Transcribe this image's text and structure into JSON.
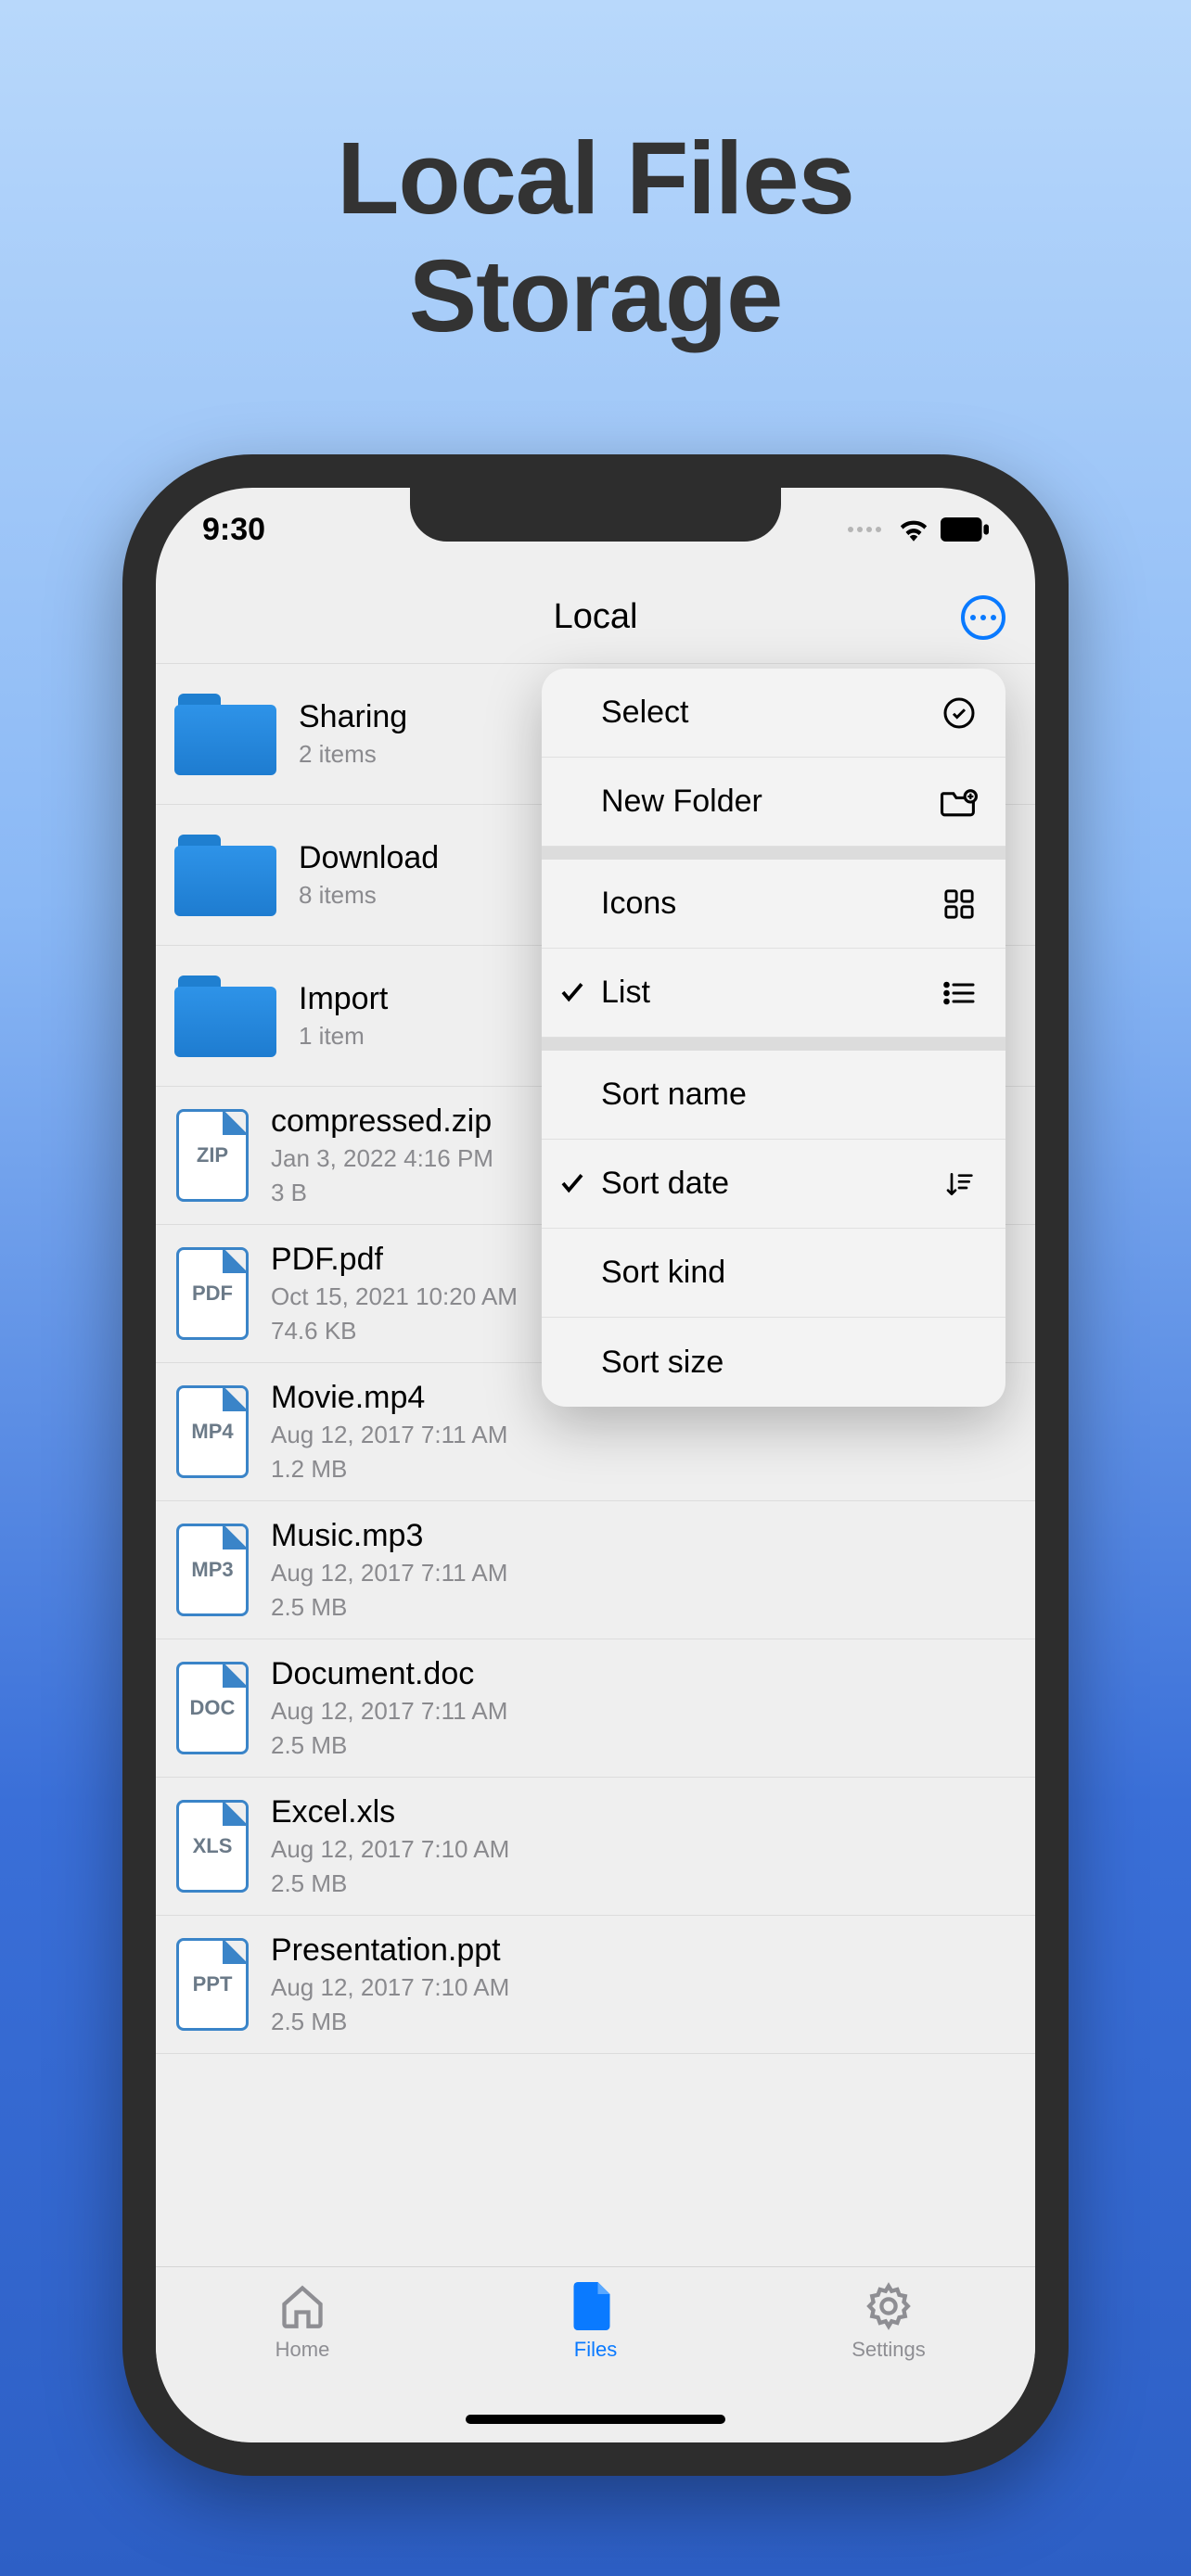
{
  "promo": {
    "line1": "Local Files",
    "line2": "Storage"
  },
  "status": {
    "time": "9:30"
  },
  "nav": {
    "title": "Local"
  },
  "folders": [
    {
      "name": "Sharing",
      "sub": "2 items"
    },
    {
      "name": "Download",
      "sub": "8 items"
    },
    {
      "name": "Import",
      "sub": "1 item"
    }
  ],
  "files": [
    {
      "ext": "ZIP",
      "name": "compressed.zip",
      "date": "Jan 3, 2022 4:16 PM",
      "size": "3 B"
    },
    {
      "ext": "PDF",
      "name": "PDF.pdf",
      "date": "Oct 15, 2021 10:20 AM",
      "size": "74.6 KB"
    },
    {
      "ext": "MP4",
      "name": "Movie.mp4",
      "date": "Aug 12, 2017 7:11 AM",
      "size": "1.2 MB"
    },
    {
      "ext": "MP3",
      "name": "Music.mp3",
      "date": "Aug 12, 2017 7:11 AM",
      "size": "2.5 MB"
    },
    {
      "ext": "DOC",
      "name": "Document.doc",
      "date": "Aug 12, 2017 7:11 AM",
      "size": "2.5 MB"
    },
    {
      "ext": "XLS",
      "name": "Excel.xls",
      "date": "Aug 12, 2017 7:10 AM",
      "size": "2.5 MB"
    },
    {
      "ext": "PPT",
      "name": "Presentation.ppt",
      "date": "Aug 12, 2017 7:10 AM",
      "size": "2.5 MB"
    }
  ],
  "menu": {
    "select": "Select",
    "newFolder": "New Folder",
    "icons": "Icons",
    "list": "List",
    "sortName": "Sort name",
    "sortDate": "Sort date",
    "sortKind": "Sort kind",
    "sortSize": "Sort size"
  },
  "tabs": {
    "home": "Home",
    "files": "Files",
    "settings": "Settings"
  }
}
